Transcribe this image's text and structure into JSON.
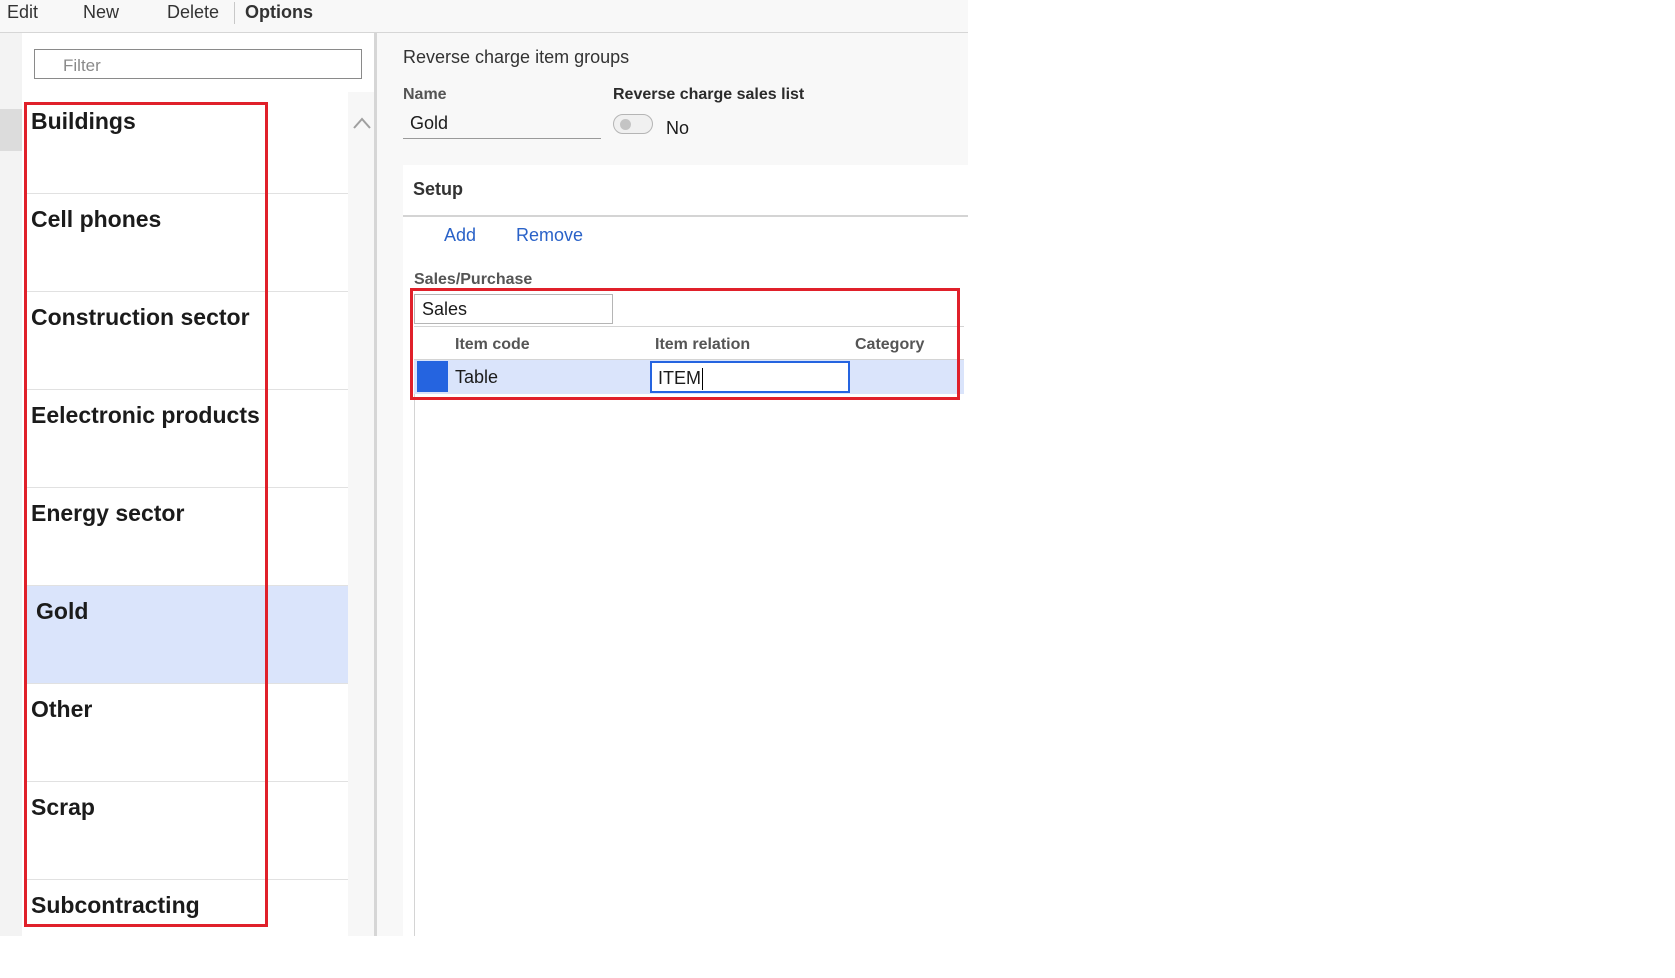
{
  "menu": {
    "items": [
      "Edit",
      "New",
      "Delete",
      "Options"
    ]
  },
  "filter": {
    "placeholder": "Filter"
  },
  "groups": {
    "items": [
      {
        "label": "Buildings"
      },
      {
        "label": "Cell phones"
      },
      {
        "label": "Construction sector"
      },
      {
        "label": "Eelectronic products"
      },
      {
        "label": "Energy sector"
      },
      {
        "label": "Gold",
        "selected": true
      },
      {
        "label": "Other"
      },
      {
        "label": "Scrap"
      },
      {
        "label": "Subcontracting"
      }
    ]
  },
  "detail": {
    "title": "Reverse charge item groups",
    "name_label": "Name",
    "name_value": "Gold",
    "sales_list_label": "Reverse charge sales list",
    "sales_list_value": "No"
  },
  "setup": {
    "title": "Setup",
    "add_label": "Add",
    "remove_label": "Remove",
    "sales_purchase_label": "Sales/Purchase",
    "sales_purchase_value": "Sales",
    "columns": [
      "Item code",
      "Item relation",
      "Category"
    ],
    "rows": [
      {
        "item_code": "Table",
        "item_relation": "ITEM",
        "category": ""
      }
    ]
  },
  "colors": {
    "highlight": "#e0202a",
    "accent": "#2564e0",
    "selection": "#dae4fb"
  }
}
